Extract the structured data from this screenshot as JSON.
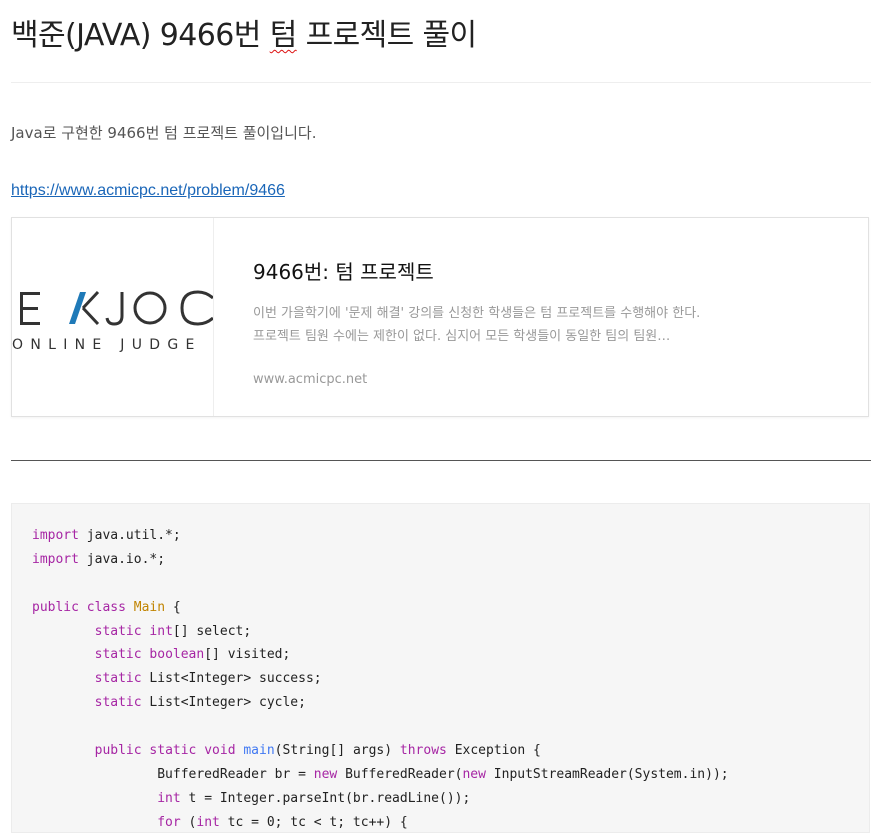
{
  "post": {
    "title_main": "백준(JAVA) 9466번 ",
    "title_spell": "텀",
    "title_rest": " 프로젝트 풀이",
    "intro": "Java로 구현한 9466번 텀 프로젝트 풀이입니다.",
    "link_text": "https://www.acmicpc.net/problem/9466"
  },
  "og_card": {
    "logo_top": "EKJOC",
    "logo_bottom": "ONLINE JUDGE",
    "title": "9466번: 텀 프로젝트",
    "description": "이번 가을학기에 '문제 해결' 강의를 신청한 학생들은 텀 프로젝트를 수행해야 한다. 프로젝트 팀원 수에는 제한이 없다. 심지어 모든 학생들이 동일한 팀의 팀원…",
    "host": "www.acmicpc.net",
    "logo_accent": "#1f7ab8"
  },
  "code": {
    "lines": [
      [
        {
          "t": "import",
          "c": "kw"
        },
        {
          "t": " java.util.*;",
          "c": ""
        }
      ],
      [
        {
          "t": "import",
          "c": "kw"
        },
        {
          "t": " java.io.*;",
          "c": ""
        }
      ],
      [],
      [
        {
          "t": "public",
          "c": "kw"
        },
        {
          "t": " ",
          "c": ""
        },
        {
          "t": "class",
          "c": "kw"
        },
        {
          "t": " ",
          "c": ""
        },
        {
          "t": "Main",
          "c": "cls"
        },
        {
          "t": " {",
          "c": ""
        }
      ],
      [
        {
          "t": "        ",
          "c": ""
        },
        {
          "t": "static",
          "c": "kw"
        },
        {
          "t": " ",
          "c": ""
        },
        {
          "t": "int",
          "c": "ty"
        },
        {
          "t": "[] select;",
          "c": ""
        }
      ],
      [
        {
          "t": "        ",
          "c": ""
        },
        {
          "t": "static",
          "c": "kw"
        },
        {
          "t": " ",
          "c": ""
        },
        {
          "t": "boolean",
          "c": "ty"
        },
        {
          "t": "[] visited;",
          "c": ""
        }
      ],
      [
        {
          "t": "        ",
          "c": ""
        },
        {
          "t": "static",
          "c": "kw"
        },
        {
          "t": " List<Integer> success;",
          "c": ""
        }
      ],
      [
        {
          "t": "        ",
          "c": ""
        },
        {
          "t": "static",
          "c": "kw"
        },
        {
          "t": " List<Integer> cycle;",
          "c": ""
        }
      ],
      [],
      [
        {
          "t": "        ",
          "c": ""
        },
        {
          "t": "public",
          "c": "kw"
        },
        {
          "t": " ",
          "c": ""
        },
        {
          "t": "static",
          "c": "kw"
        },
        {
          "t": " ",
          "c": ""
        },
        {
          "t": "void",
          "c": "ty"
        },
        {
          "t": " ",
          "c": ""
        },
        {
          "t": "main",
          "c": "fn"
        },
        {
          "t": "(String[] args) ",
          "c": ""
        },
        {
          "t": "throws",
          "c": "kw"
        },
        {
          "t": " Exception {",
          "c": ""
        }
      ],
      [
        {
          "t": "                BufferedReader br = ",
          "c": ""
        },
        {
          "t": "new",
          "c": "kw"
        },
        {
          "t": " BufferedReader(",
          "c": ""
        },
        {
          "t": "new",
          "c": "kw"
        },
        {
          "t": " InputStreamReader(System.in));",
          "c": ""
        }
      ],
      [
        {
          "t": "                ",
          "c": ""
        },
        {
          "t": "int",
          "c": "ty"
        },
        {
          "t": " t = Integer.parseInt(br.readLine());",
          "c": ""
        }
      ],
      [
        {
          "t": "                ",
          "c": ""
        },
        {
          "t": "for",
          "c": "kw"
        },
        {
          "t": " (",
          "c": ""
        },
        {
          "t": "int",
          "c": "ty"
        },
        {
          "t": " tc = 0; tc < t; tc++) {",
          "c": ""
        }
      ]
    ]
  }
}
